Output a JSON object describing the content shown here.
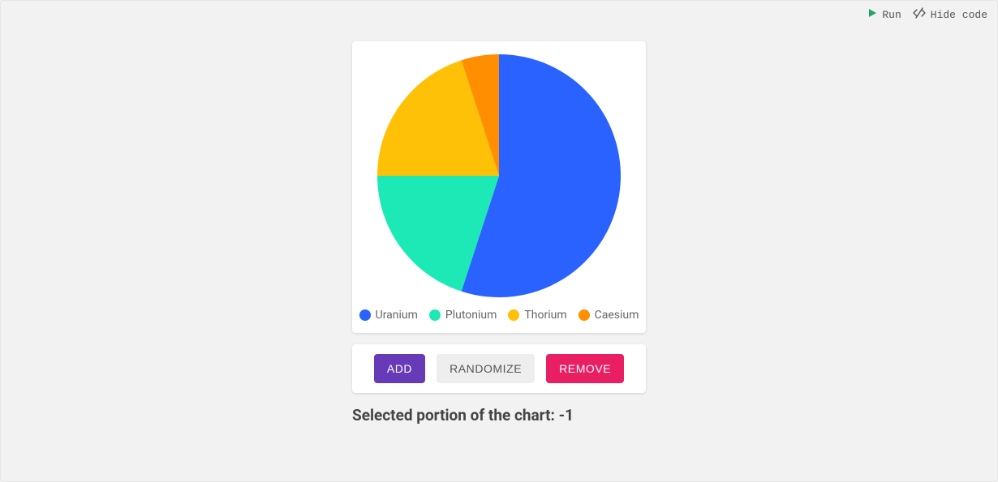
{
  "toolbar": {
    "run_label": "Run",
    "hide_code_label": "Hide code"
  },
  "chart_data": {
    "type": "pie",
    "categories": [
      "Uranium",
      "Plutonium",
      "Thorium",
      "Caesium"
    ],
    "values": [
      55,
      20,
      20,
      5
    ],
    "series": [
      {
        "name": "Uranium",
        "value": 55,
        "color": "#2962ff"
      },
      {
        "name": "Plutonium",
        "value": 20,
        "color": "#1de9b6"
      },
      {
        "name": "Thorium",
        "value": 20,
        "color": "#ffc107"
      },
      {
        "name": "Caesium",
        "value": 5,
        "color": "#ff8f00"
      }
    ]
  },
  "buttons": {
    "add": "Add",
    "randomize": "Randomize",
    "remove": "Remove"
  },
  "status": {
    "label": "Selected portion of the chart:",
    "value": "-1"
  }
}
